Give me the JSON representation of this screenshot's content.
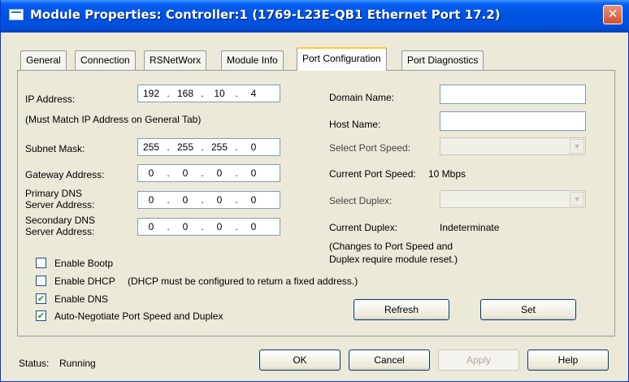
{
  "window": {
    "title": "Module Properties: Controller:1 (1769-L23E-QB1 Ethernet Port 17.2)",
    "close_glyph": "✕"
  },
  "tabs": [
    {
      "label": "General"
    },
    {
      "label": "Connection"
    },
    {
      "label": "RSNetWorx"
    },
    {
      "label": "Module Info"
    },
    {
      "label": "Port Configuration"
    },
    {
      "label": "Port Diagnostics"
    }
  ],
  "active_tab": "Port Configuration",
  "left": {
    "ip_label": "IP Address:",
    "ip_value": [
      "192",
      "168",
      "10",
      "4"
    ],
    "ip_note": "(Must Match IP Address on General Tab)",
    "subnet_label": "Subnet Mask:",
    "subnet_value": [
      "255",
      "255",
      "255",
      "0"
    ],
    "gateway_label": "Gateway Address:",
    "gateway_value": [
      "0",
      "0",
      "0",
      "0"
    ],
    "primary_dns_label_1": "Primary DNS",
    "primary_dns_label_2": "Server Address:",
    "primary_dns_value": [
      "0",
      "0",
      "0",
      "0"
    ],
    "secondary_dns_label_1": "Secondary DNS",
    "secondary_dns_label_2": "Server Address:",
    "secondary_dns_value": [
      "0",
      "0",
      "0",
      "0"
    ],
    "ip_dot": "."
  },
  "right": {
    "domain_label": "Domain Name:",
    "domain_value": "",
    "host_label": "Host Name:",
    "host_value": "",
    "select_speed_label": "Select Port Speed:",
    "select_speed_value": "",
    "current_speed_label": "Current Port Speed:",
    "current_speed_value": "10 Mbps",
    "select_duplex_label": "Select Duplex:",
    "select_duplex_value": "",
    "current_duplex_label": "Current Duplex:",
    "current_duplex_value": "Indeterminate",
    "reset_note_1": "(Changes to Port Speed and",
    "reset_note_2": "Duplex require module reset.)",
    "combo_arrow": "▼"
  },
  "checkboxes": {
    "bootp": {
      "label": "Enable Bootp",
      "checked": false
    },
    "dhcp": {
      "label": "Enable DHCP",
      "note": "(DHCP must be configured to return a fixed address.)",
      "checked": false
    },
    "dns": {
      "label": "Enable DNS",
      "checked": true
    },
    "autoneg": {
      "label": "Auto-Negotiate Port Speed and Duplex",
      "checked": true
    }
  },
  "buttons": {
    "refresh": "Refresh",
    "set": "Set",
    "ok": "OK",
    "cancel": "Cancel",
    "apply": "Apply",
    "help": "Help"
  },
  "status": {
    "label": "Status:",
    "value": "Running"
  }
}
